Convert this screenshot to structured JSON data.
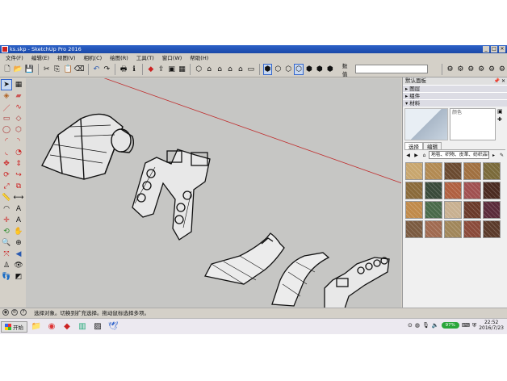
{
  "window": {
    "title": "ks.skp - SketchUp Pro 2016",
    "minimize": "_",
    "maximize": "□",
    "close": "×"
  },
  "menu": [
    "文件(F)",
    "编辑(E)",
    "视图(V)",
    "相机(C)",
    "绘图(R)",
    "工具(T)",
    "窗口(W)",
    "帮助(H)"
  ],
  "toolbar": {
    "measure_label": "数值",
    "measure_value": ""
  },
  "tray": {
    "title": "默认面板",
    "sections": [
      {
        "arrow": "▸",
        "label": "图层"
      },
      {
        "arrow": "▸",
        "label": "组件"
      },
      {
        "arrow": "▾",
        "label": "材料"
      }
    ],
    "material_name_placeholder": "颜色",
    "tabs": [
      "选择",
      "编辑"
    ],
    "material_category": "地毯、织物、皮革、纺织品和墙..."
  },
  "status": {
    "message": "选择对象。切换到扩充选择。拖动鼠标选择多项。"
  },
  "taskbar": {
    "start_label": "开始",
    "network_badge": "97%",
    "time": "22:52",
    "date": "2016/7/23"
  },
  "colors": {
    "title_bar": "#1a48a8",
    "viewport_bg": "#c6c6c4",
    "axis_red": "#c03030",
    "chrome": "#d4d0c8"
  },
  "swatch_colors": [
    "#c8a66e",
    "#b28a52",
    "#6a4a30",
    "#a07040",
    "#7a6a3a",
    "#8a6a3a",
    "#3a4a3a",
    "#b06040",
    "#a05050",
    "#4a2a20",
    "#c08a4a",
    "#4a6a4a",
    "#c8b090",
    "#6a3a2a",
    "#5a2a3a",
    "#7a5a40",
    "#a06a50",
    "#a0865a",
    "#8a4a3a",
    "#5a3a2a"
  ]
}
